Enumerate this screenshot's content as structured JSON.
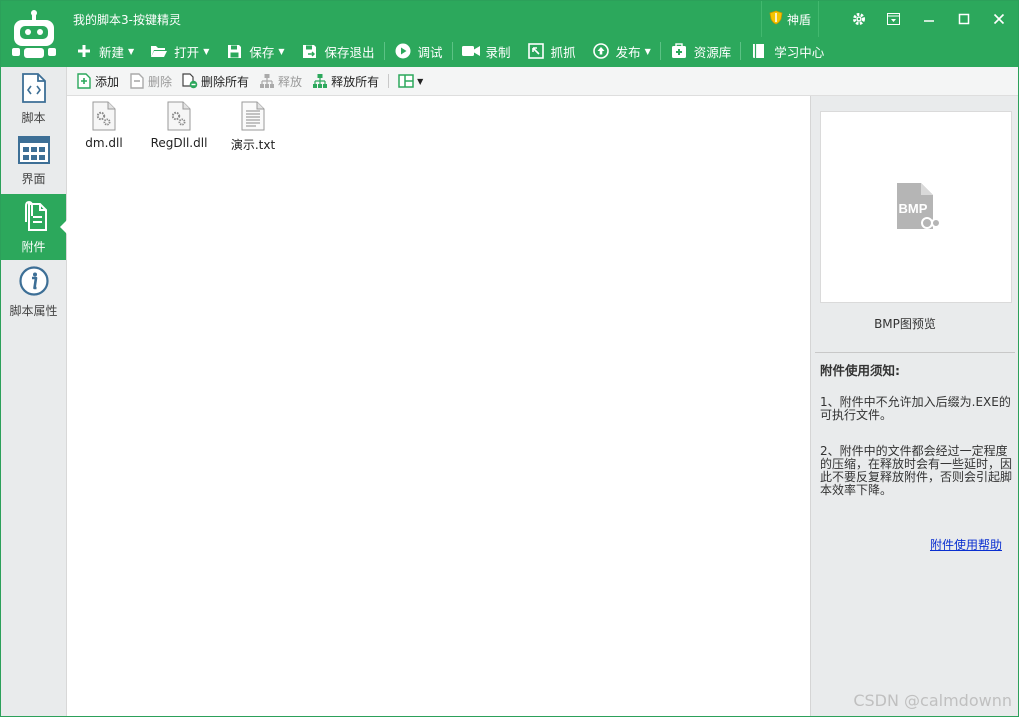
{
  "window": {
    "title": "我的脚本3-按键精灵",
    "shield_label": "神盾"
  },
  "toolbar": {
    "new": "新建",
    "open": "打开",
    "save": "保存",
    "save_exit": "保存退出",
    "debug": "调试",
    "record": "录制",
    "capture": "抓抓",
    "publish": "发布",
    "resources": "资源库",
    "learning": "学习中心"
  },
  "sidebar": {
    "items": [
      {
        "label": "脚本",
        "icon": "script-icon"
      },
      {
        "label": "界面",
        "icon": "interface-icon"
      },
      {
        "label": "附件",
        "icon": "attachment-icon",
        "active": true
      },
      {
        "label": "脚本属性",
        "icon": "info-icon"
      }
    ]
  },
  "attach_toolbar": {
    "add": "添加",
    "delete": "删除",
    "delete_all": "删除所有",
    "release": "释放",
    "release_all": "释放所有"
  },
  "files": [
    {
      "name": "dm.dll",
      "icon": "dll-file-icon"
    },
    {
      "name": "RegDll.dll",
      "icon": "dll-file-icon"
    },
    {
      "name": "演示.txt",
      "icon": "txt-file-icon"
    }
  ],
  "preview": {
    "badge": "BMP",
    "label": "BMP图预览"
  },
  "notice": {
    "title": "附件使用须知:",
    "item1": "1、附件中不允许加入后缀为.EXE的可执行文件。",
    "item2": "2、附件中的文件都会经过一定程度的压缩，在释放时会有一些延时，因此不要反复释放附件，否则会引起脚本效率下降。",
    "help_link": "附件使用帮助"
  },
  "watermark": "CSDN @calmdownn",
  "colors": {
    "brand_green": "#2ca85c",
    "sidebar_bg": "#e9ebec",
    "link_blue": "#0a2fd0"
  }
}
